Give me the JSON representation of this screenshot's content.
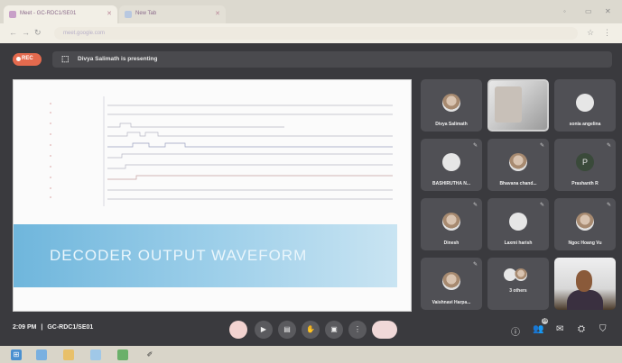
{
  "browser": {
    "tabs": [
      {
        "label": "Meet - GC-RDC1/SE01",
        "active": true
      },
      {
        "label": "New Tab",
        "active": false
      }
    ],
    "url": "meet.google.com"
  },
  "meet": {
    "rec_label": "REC",
    "presenting_text": "Divya Salimath is presenting",
    "slide": {
      "banner_title": "DECODER OUTPUT WAVEFORM"
    },
    "participants": [
      {
        "name": "Divya Salimath",
        "kind": "photo"
      },
      {
        "name": "",
        "kind": "video"
      },
      {
        "name": "sonia angelina",
        "kind": "avatar"
      },
      {
        "name": "BASHIRUTHA N...",
        "kind": "avatar"
      },
      {
        "name": "Bhavana chand...",
        "kind": "photo"
      },
      {
        "name": "Prashanth R",
        "kind": "letter",
        "letter": "P"
      },
      {
        "name": "Dinesh",
        "kind": "photo"
      },
      {
        "name": "Laxmi harish",
        "kind": "avatar"
      },
      {
        "name": "Ngoc Hoang Vu",
        "kind": "photo"
      },
      {
        "name": "Vaishnavi Harpa...",
        "kind": "photo"
      },
      {
        "name": "3 others",
        "kind": "others"
      },
      {
        "name": "",
        "kind": "selfview"
      }
    ],
    "bottom": {
      "time": "2:09 PM",
      "separator": "|",
      "meeting_code": "GC-RDC1/SE01",
      "people_count": "16"
    }
  },
  "colors": {
    "rec": "#e46a4e",
    "meet_bg": "#3a3a3e",
    "tile_bg": "#505055",
    "banner": "#6fb6dc"
  }
}
